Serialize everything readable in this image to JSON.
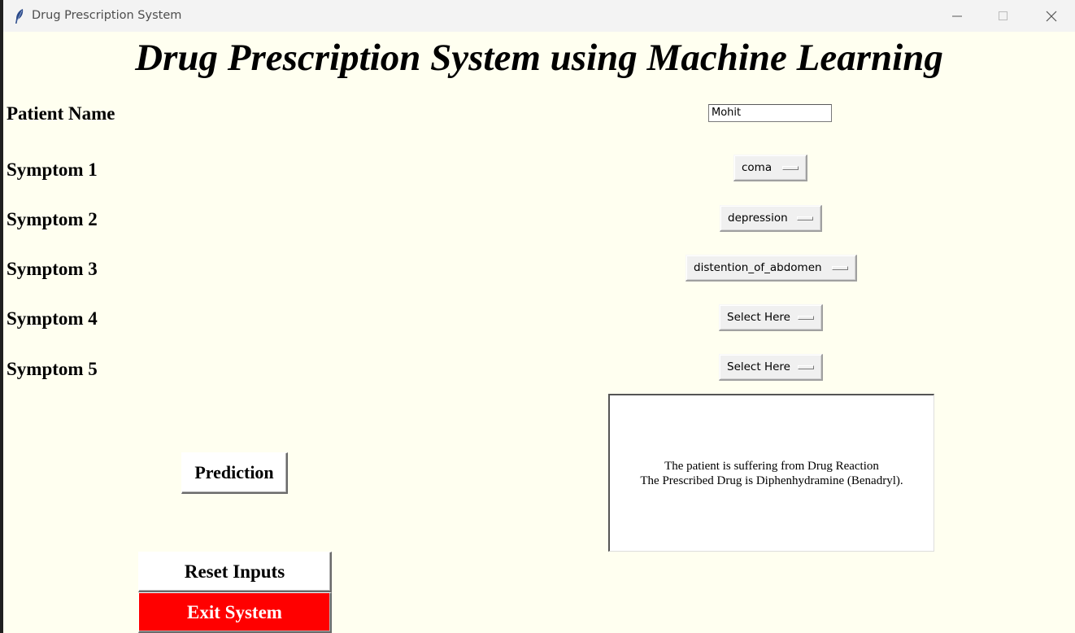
{
  "window": {
    "title": "Drug Prescription System",
    "controls": {
      "minimize": "minimize-icon",
      "maximize": "maximize-icon",
      "close": "close-icon"
    }
  },
  "app": {
    "title": "Drug Prescription System using Machine Learning"
  },
  "form": {
    "patient_name_label": "Patient Name",
    "patient_name_value": "Mohit",
    "symptoms": [
      {
        "label": "Symptom 1",
        "value": "coma"
      },
      {
        "label": "Symptom 2",
        "value": "depression"
      },
      {
        "label": "Symptom 3",
        "value": "distention_of_abdomen"
      },
      {
        "label": "Symptom 4",
        "value": "Select Here"
      },
      {
        "label": "Symptom 5",
        "value": "Select Here"
      }
    ]
  },
  "result": {
    "line1": "The patient is suffering from Drug Reaction",
    "line2": "The Prescribed Drug is Diphenhydramine (Benadryl)."
  },
  "buttons": {
    "prediction": "Prediction",
    "reset": "Reset Inputs",
    "exit": "Exit System"
  },
  "colors": {
    "background": "#fffff0",
    "exit_button": "#ff0000",
    "button": "#ffffff"
  }
}
